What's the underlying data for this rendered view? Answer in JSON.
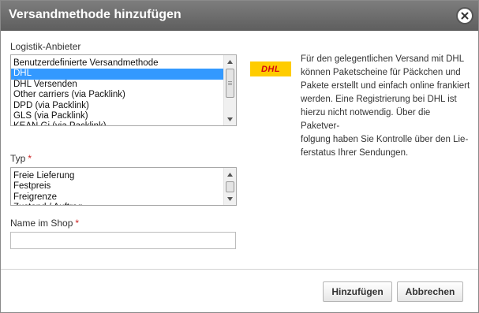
{
  "dialog": {
    "title": "Versandmethode hinzufügen",
    "close_icon": "close-icon"
  },
  "carrier": {
    "label": "Logistik-Anbieter",
    "options": [
      "Benutzerdefinierte Versandmethode",
      "DHL",
      "DHL Versenden",
      "Other carriers (via Packlink)",
      "DPD (via Packlink)",
      "GLS (via Packlink)",
      "KEAN Gi (via Packlink)"
    ],
    "selected": "DHL"
  },
  "carrier_info": {
    "logo_text": "DHL",
    "logo_colors": {
      "background": "#ffcc00",
      "text": "#d40511"
    },
    "description_lines": [
      "Für den gelegentlichen Versand mit DHL",
      "können Paketscheine für Päckchen und",
      "Pakete erstellt und einfach online frankiert",
      "werden. Eine Registrierung bei DHL ist",
      "hierzu nicht notwendig. Über die Paketver-",
      "folgung haben Sie Kontrolle über den Lie-",
      "ferstatus Ihrer Sendungen."
    ]
  },
  "type": {
    "label": "Typ",
    "required_mark": "*",
    "options": [
      "Freie Lieferung",
      "Festpreis",
      "Freigrenze",
      "Zustand / Auftrag"
    ]
  },
  "shop_name": {
    "label": "Name im Shop",
    "required_mark": "*",
    "value": ""
  },
  "buttons": {
    "add": "Hinzufügen",
    "cancel": "Abbrechen"
  },
  "colors": {
    "titlebar": "#6a6a6a",
    "selection": "#3399ff",
    "required": "#cc2222"
  }
}
